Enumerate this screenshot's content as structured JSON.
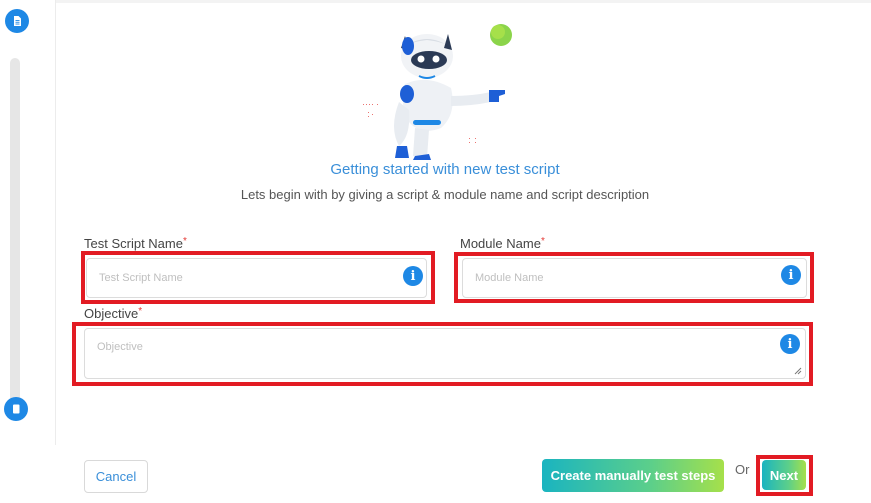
{
  "header": {
    "title": "Getting started with new test script",
    "subtitle": "Lets begin with by giving a script & module name and script description"
  },
  "form": {
    "script_name": {
      "label": "Test Script Name",
      "required": "*",
      "placeholder": "Test Script Name",
      "value": ""
    },
    "module_name": {
      "label": "Module Name",
      "required": "*",
      "placeholder": "Module Name",
      "value": ""
    },
    "objective": {
      "label": "Objective",
      "required": "*",
      "placeholder": "Objective",
      "value": ""
    }
  },
  "footer": {
    "cancel_label": "Cancel",
    "manual_label": "Create manually test steps",
    "or_label": "Or",
    "next_label": "Next"
  },
  "colors": {
    "accent": "#1e88e5",
    "title": "#3a8fd9",
    "highlight": "#e21b23",
    "gradient_start": "#1ab4c0",
    "gradient_end": "#a6e04a"
  },
  "icons": {
    "step_top": "document-icon",
    "step_bottom": "page-icon",
    "field_info": "info-icon"
  }
}
